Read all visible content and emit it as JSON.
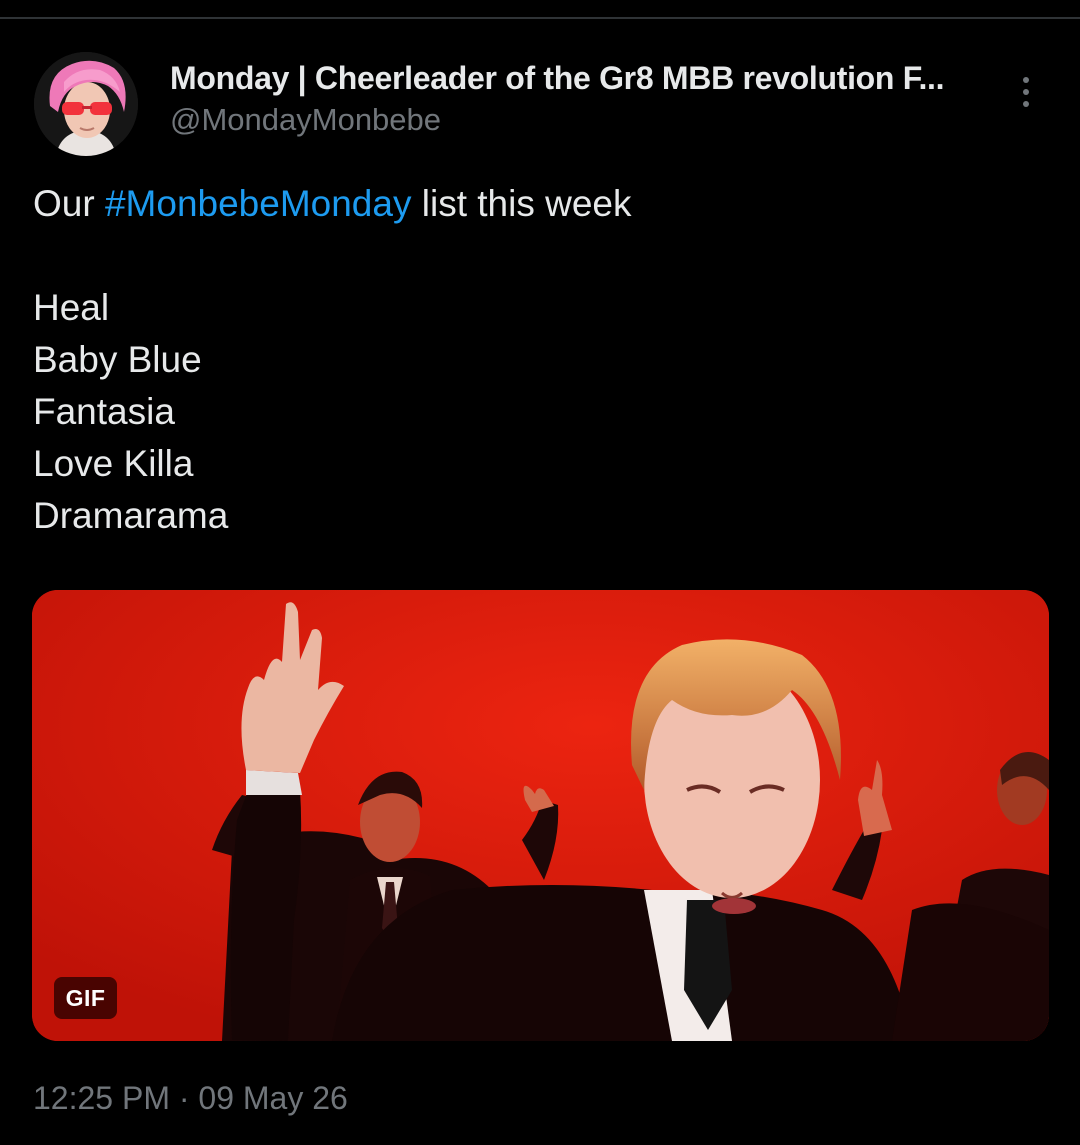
{
  "author": {
    "name": "Monday | Cheerleader of the Gr8 MBB revolution F...",
    "handle": "@MondayMonbebe",
    "avatar_icon": "profile-avatar-pink-hair"
  },
  "more_options_icon": "vertical-ellipsis-icon",
  "tweet": {
    "intro_prefix": "Our ",
    "hashtag": "#MonbebeMonday",
    "intro_suffix": " list this week",
    "songs": [
      "Heal",
      "Baby Blue",
      "Fantasia",
      "Love Killa",
      "Dramarama"
    ]
  },
  "media": {
    "badge": "GIF",
    "description_icon": "gif-image"
  },
  "timestamp": "12:25 PM · 09 May 26",
  "colors": {
    "background": "#000000",
    "text": "#e7e9ea",
    "secondary_text": "#71767b",
    "hashtag": "#1d9bf0",
    "media_background": "#d21509"
  }
}
